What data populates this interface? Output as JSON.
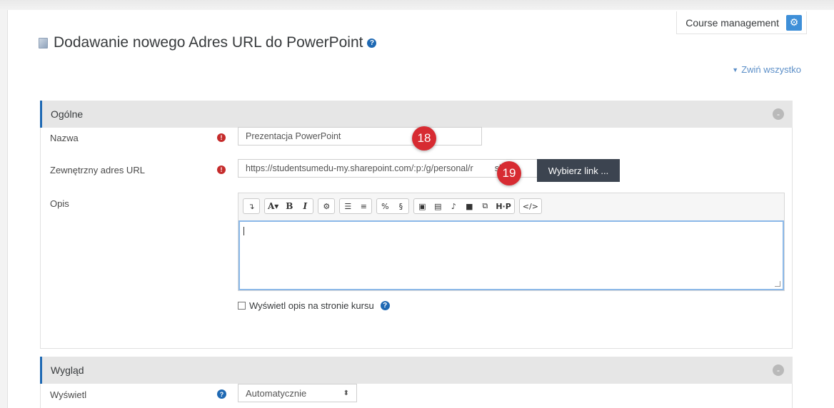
{
  "header": {
    "course_management_label": "Course management",
    "gear_icon": "gear-icon"
  },
  "page": {
    "title": "Dodawanie nowego Adres URL do PowerPoint",
    "collapse_all": "Zwiń wszystko"
  },
  "sections": {
    "general": {
      "title": "Ogólne",
      "name_label": "Nazwa",
      "name_value": "Prezentacja PowerPoint",
      "url_label": "Zewnętrzny adres URL",
      "url_value": "https://studentsumedu-my.sharepoint.com/:p:/g/personal/r",
      "url_value_tail": "ski_3",
      "pick_link_button": "Wybierz link ...",
      "description_label": "Opis",
      "show_description_label": "Wyświetl opis na stronie kursu"
    },
    "appearance": {
      "title": "Wygląd",
      "display_label": "Wyświetl",
      "display_value": "Automatycznie"
    }
  },
  "annotations": {
    "badge_18": "18",
    "badge_19": "19"
  },
  "editor_toolbar": [
    "show-more",
    "font-size",
    "bold",
    "italic",
    "settings",
    "unordered-list",
    "ordered-list",
    "link",
    "unlink",
    "image",
    "media",
    "record-audio",
    "record-video",
    "manage-files",
    "h5p",
    "html"
  ],
  "colors": {
    "accent": "#1f69b3",
    "required": "#c52b2b",
    "badge": "#d72b32",
    "button_dark": "#3c4450"
  }
}
